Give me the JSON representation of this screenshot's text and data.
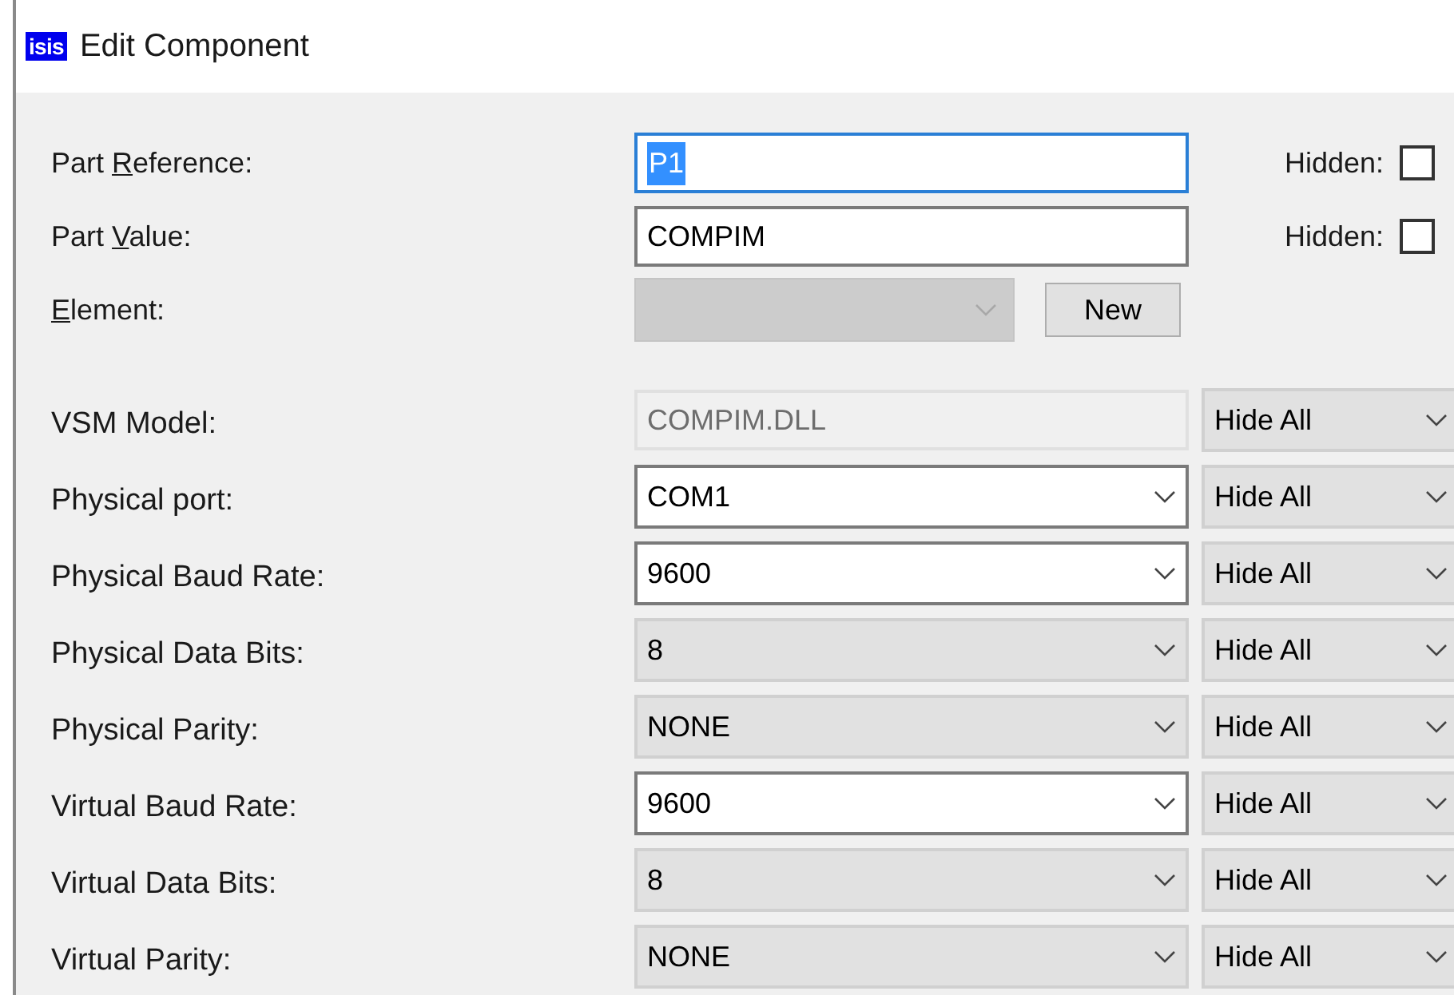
{
  "window": {
    "logo": "isis",
    "title": "Edit Component"
  },
  "main_fields": [
    {
      "label": {
        "before": "Part ",
        "key": "R",
        "after": "eference:"
      },
      "field": {
        "kind": "text",
        "value": "P1",
        "focused": true,
        "selected": true
      },
      "hidden": {
        "label": "Hidden:",
        "checked": false
      }
    },
    {
      "label": {
        "before": "Part ",
        "key": "V",
        "after": "alue:"
      },
      "field": {
        "kind": "text",
        "value": "COMPIM",
        "focused": false,
        "selected": false
      },
      "hidden": {
        "label": "Hidden:",
        "checked": false
      }
    },
    {
      "label": {
        "key": "E",
        "after": "lement:"
      },
      "field": {
        "kind": "combo",
        "disabled": true
      },
      "button": "New"
    }
  ],
  "properties": [
    {
      "label": "VSM Model:",
      "field": {
        "kind": "text",
        "value": "COMPIM.DLL",
        "read_only": true
      },
      "visibility": "Hide All"
    },
    {
      "label": "Physical port:",
      "field": {
        "kind": "combo",
        "value": "COM1",
        "editable": true
      },
      "visibility": "Hide All"
    },
    {
      "label": "Physical Baud Rate:",
      "field": {
        "kind": "combo",
        "value": "9600",
        "editable": true
      },
      "visibility": "Hide All"
    },
    {
      "label": "Physical Data Bits:",
      "field": {
        "kind": "combo",
        "value": "8",
        "editable": false
      },
      "visibility": "Hide All"
    },
    {
      "label": "Physical Parity:",
      "field": {
        "kind": "combo",
        "value": "NONE",
        "editable": false
      },
      "visibility": "Hide All"
    },
    {
      "label": "Virtual Baud Rate:",
      "field": {
        "kind": "combo",
        "value": "9600",
        "editable": true
      },
      "visibility": "Hide All"
    },
    {
      "label": "Virtual Data Bits:",
      "field": {
        "kind": "combo",
        "value": "8",
        "editable": false
      },
      "visibility": "Hide All"
    },
    {
      "label": "Virtual Parity:",
      "field": {
        "kind": "combo",
        "value": "NONE",
        "editable": false
      },
      "visibility": "Hide All"
    }
  ]
}
